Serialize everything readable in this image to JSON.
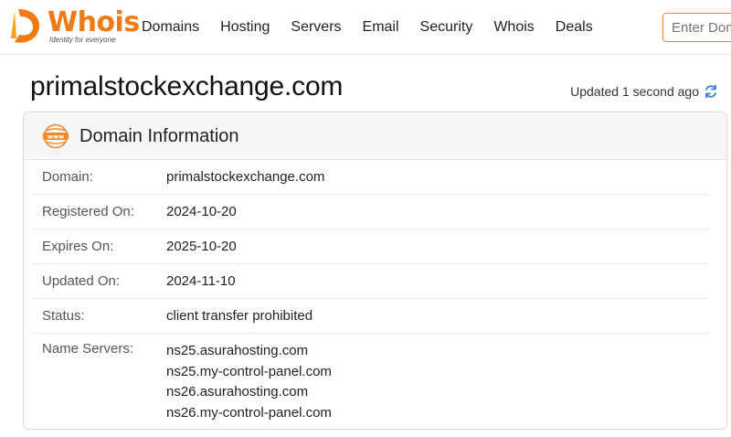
{
  "header": {
    "logo_text": "Whois",
    "logo_tagline": "Identity for everyone",
    "nav": [
      "Domains",
      "Hosting",
      "Servers",
      "Email",
      "Security",
      "Whois",
      "Deals"
    ],
    "search_placeholder": "Enter Domain"
  },
  "page": {
    "title": "primalstockexchange.com",
    "updated": "Updated 1 second ago"
  },
  "domain_info": {
    "title": "Domain Information",
    "icon_text": "www",
    "rows": [
      {
        "label": "Domain:",
        "value": "primalstockexchange.com"
      },
      {
        "label": "Registered On:",
        "value": "2024-10-20"
      },
      {
        "label": "Expires On:",
        "value": "2025-10-20"
      },
      {
        "label": "Updated On:",
        "value": "2024-11-10"
      },
      {
        "label": "Status:",
        "value": "client transfer prohibited"
      }
    ],
    "name_servers_label": "Name Servers:",
    "name_servers": [
      "ns25.asurahosting.com",
      "ns25.my-control-panel.com",
      "ns26.asurahosting.com",
      "ns26.my-control-panel.com"
    ]
  },
  "colors": {
    "brand": "#f07a14",
    "refresh": "#2f7ee0"
  }
}
